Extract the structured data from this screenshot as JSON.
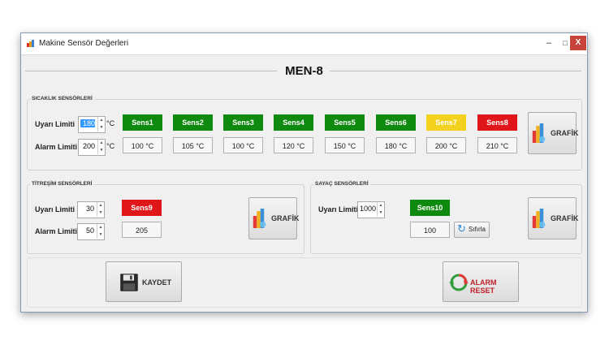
{
  "window": {
    "title": "Makine Sensör Değerleri",
    "minimize": "–",
    "maximize": "□",
    "close": "X"
  },
  "main_title": "MEN-8",
  "sicaklik": {
    "group_label": "SICAKLIK SENSÖRLERİ",
    "uyan_label": "Uyarı Limiti",
    "uyan_value": "180",
    "alarm_label": "Alarm Limiti",
    "alarm_value": "200",
    "unit": "°C",
    "sensors": [
      {
        "name": "Sens1",
        "value": "100 °C",
        "color": "#0e8a0e"
      },
      {
        "name": "Sens2",
        "value": "105 °C",
        "color": "#0e8a0e"
      },
      {
        "name": "Sens3",
        "value": "100 °C",
        "color": "#0e8a0e"
      },
      {
        "name": "Sens4",
        "value": "120 °C",
        "color": "#0e8a0e"
      },
      {
        "name": "Sens5",
        "value": "150 °C",
        "color": "#0e8a0e"
      },
      {
        "name": "Sens6",
        "value": "180 °C",
        "color": "#0e8a0e"
      },
      {
        "name": "Sens7",
        "value": "200 °C",
        "color": "#f2d21e"
      },
      {
        "name": "Sens8",
        "value": "210 °C",
        "color": "#e0161a"
      }
    ],
    "grafik_label": "GRAFİK"
  },
  "titresim": {
    "group_label": "TİTREŞİM SENSÖRLERİ",
    "uyan_label": "Uyarı Limiti",
    "uyan_value": "30",
    "alarm_label": "Alarm Limiti",
    "alarm_value": "50",
    "sensor": {
      "name": "Sens9",
      "value": "205",
      "color": "#e0161a"
    },
    "grafik_label": "GRAFİK"
  },
  "sayac": {
    "group_label": "SAYAÇ SENSÖRLERİ",
    "uyan_label": "Uyarı Limiti",
    "uyan_value": "1000",
    "sensor": {
      "name": "Sens10",
      "value": "100",
      "color": "#0e8a0e"
    },
    "reset_label": "Sıfırla",
    "grafik_label": "GRAFİK"
  },
  "kaydet_label": "KAYDET",
  "alarm_reset_label": "ALARM RESET"
}
